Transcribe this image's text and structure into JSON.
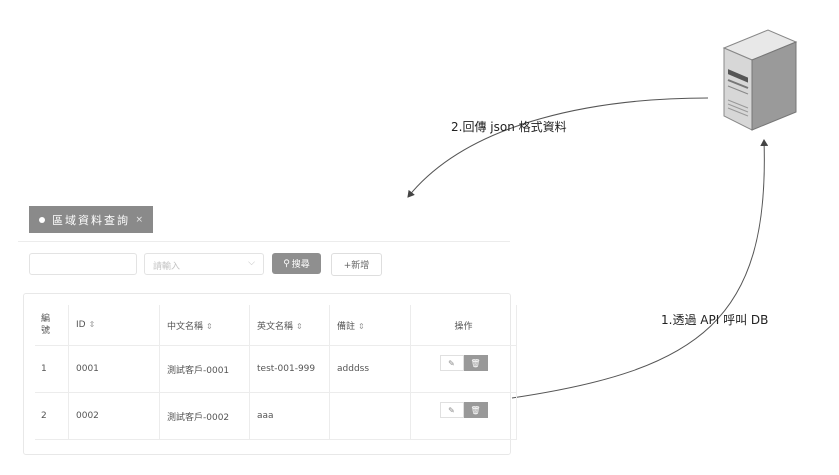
{
  "labels": {
    "return_json": "2.回傳 json 格式資料",
    "call_api": "1.透過 API 呼叫 DB"
  },
  "tab": {
    "title": "區域資料查詢",
    "close": "×"
  },
  "search": {
    "select_placeholder": "請輸入",
    "search_label": "搜尋",
    "add_label": "+新增"
  },
  "table": {
    "headers": [
      "編號",
      "ID",
      "中文名稱",
      "英文名稱",
      "備註",
      "操作"
    ],
    "rows": [
      {
        "no": "1",
        "id": "0001",
        "cname": "測試客戶-0001",
        "ename": "test-001-999",
        "note": "adddss"
      },
      {
        "no": "2",
        "id": "0002",
        "cname": "測試客戶-0002",
        "ename": "aaa",
        "note": ""
      }
    ]
  }
}
